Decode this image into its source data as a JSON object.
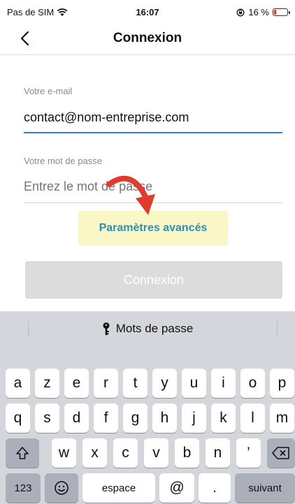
{
  "status_bar": {
    "carrier": "Pas de SIM",
    "time": "16:07",
    "battery": "16 %",
    "battery_level": 0.16
  },
  "nav": {
    "title": "Connexion"
  },
  "form": {
    "email_label": "Votre e-mail",
    "email_value": "contact@nom-entreprise.com",
    "password_label": "Votre mot de passe",
    "password_placeholder": "Entrez le mot de passe",
    "advanced_link": "Paramètres avancés",
    "submit_label": "Connexion"
  },
  "colors": {
    "accent": "#2e8fb0",
    "email_underline": "#2f7de1",
    "arrow": "#e23b2e",
    "highlight": "#faf6c6",
    "button_disabled": "#dcdcdc"
  },
  "keyboard": {
    "suggestion": "Mots de passe",
    "row1": [
      "a",
      "z",
      "e",
      "r",
      "t",
      "y",
      "u",
      "i",
      "o",
      "p"
    ],
    "row2": [
      "q",
      "s",
      "d",
      "f",
      "g",
      "h",
      "j",
      "k",
      "l",
      "m"
    ],
    "row3": [
      "w",
      "x",
      "c",
      "v",
      "b",
      "n",
      "’"
    ],
    "numbers_key": "123",
    "space_key": "espace",
    "at_key": "@",
    "dot_key": ".",
    "next_key": "suivant",
    "icons": [
      "key-icon",
      "shift-icon",
      "delete-icon",
      "emoji-icon"
    ]
  }
}
